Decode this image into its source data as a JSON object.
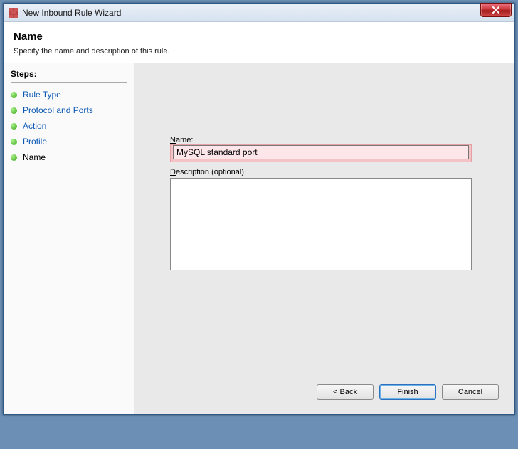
{
  "window": {
    "title": "New Inbound Rule Wizard"
  },
  "header": {
    "title": "Name",
    "subtitle": "Specify the name and description of this rule."
  },
  "sidebar": {
    "stepsLabel": "Steps:",
    "items": [
      {
        "label": "Rule Type"
      },
      {
        "label": "Protocol and Ports"
      },
      {
        "label": "Action"
      },
      {
        "label": "Profile"
      },
      {
        "label": "Name"
      }
    ]
  },
  "form": {
    "nameLabelPrefix": "N",
    "nameLabelRest": "ame:",
    "nameValue": "MySQL standard port",
    "descLabelPrefix": "D",
    "descLabelRest": "escription (optional):",
    "descValue": ""
  },
  "buttons": {
    "back": "< Back",
    "finish": "Finish",
    "cancel": "Cancel"
  }
}
